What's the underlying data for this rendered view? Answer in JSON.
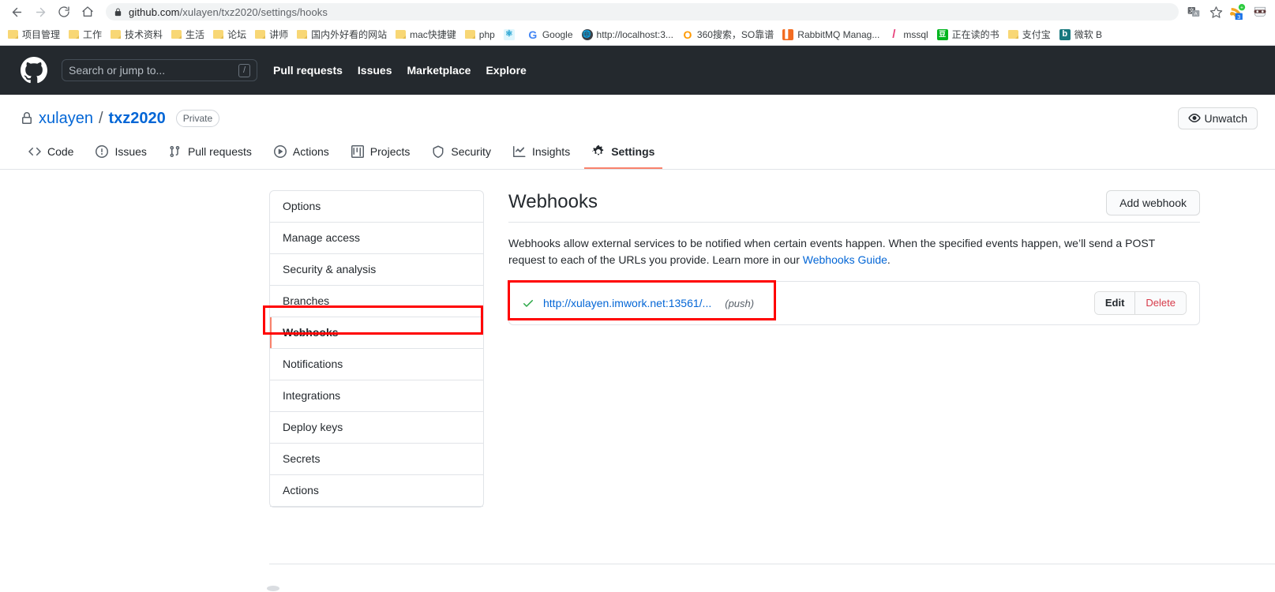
{
  "browser": {
    "url_domain": "github.com",
    "url_path": "/xulayen/txz2020/settings/hooks",
    "back_label": "Back",
    "forward_label": "Forward",
    "reload_label": "Reload",
    "home_label": "Home",
    "lock_icon": "lock-icon",
    "translate_icon": "translate-icon",
    "bookmark_star_icon": "star-icon",
    "extension_rss_badge": "3",
    "bookmarks": [
      {
        "label": "项目管理",
        "icon": "folder-icon",
        "type": "folder"
      },
      {
        "label": "工作",
        "icon": "folder-icon",
        "type": "folder"
      },
      {
        "label": "技术资料",
        "icon": "folder-icon",
        "type": "folder"
      },
      {
        "label": "生活",
        "icon": "folder-icon",
        "type": "folder"
      },
      {
        "label": "论坛",
        "icon": "folder-icon",
        "type": "folder"
      },
      {
        "label": "讲师",
        "icon": "folder-icon",
        "type": "folder"
      },
      {
        "label": "国内外好看的网站",
        "icon": "folder-icon",
        "type": "folder"
      },
      {
        "label": "mac快捷键",
        "icon": "folder-icon",
        "type": "folder"
      },
      {
        "label": "php",
        "icon": "folder-icon",
        "type": "folder"
      },
      {
        "label": "",
        "icon": "react-icon",
        "type": "site",
        "color": "#61dafb",
        "glyph": "⚛"
      },
      {
        "label": "Google",
        "icon": "google-icon",
        "type": "site",
        "color": "#ffffff",
        "glyph": "G"
      },
      {
        "label": "http://localhost:3...",
        "icon": "globe-icon",
        "type": "site",
        "color": "#3b4046",
        "glyph": "◑"
      },
      {
        "label": "360搜索，SO靠谱",
        "icon": "so360-icon",
        "type": "site",
        "color": "#ffffff",
        "glyph": "O"
      },
      {
        "label": "RabbitMQ Manag...",
        "icon": "rabbitmq-icon",
        "type": "site",
        "color": "#f36c21",
        "glyph": "▐"
      },
      {
        "label": "mssql",
        "icon": "pencil-icon",
        "type": "site",
        "color": "#ffffff",
        "glyph": "/"
      },
      {
        "label": "正在读的书",
        "icon": "douban-icon",
        "type": "site",
        "color": "#00b51d",
        "glyph": "豆"
      },
      {
        "label": "支付宝",
        "icon": "folder-icon",
        "type": "folder"
      },
      {
        "label": "微软 B",
        "icon": "bing-icon",
        "type": "site",
        "color": "#17787e",
        "glyph": "b"
      }
    ]
  },
  "gh_header": {
    "logo_icon": "github-mark-icon",
    "search_placeholder": "Search or jump to...",
    "search_value": "",
    "search_shortcut": "/",
    "nav": [
      {
        "label": "Pull requests"
      },
      {
        "label": "Issues"
      },
      {
        "label": "Marketplace"
      },
      {
        "label": "Explore"
      }
    ]
  },
  "repo": {
    "lock_icon": "lock-icon",
    "owner": "xulayen",
    "separator": "/",
    "name": "txz2020",
    "visibility": "Private",
    "watch_button": "Unwatch",
    "watch_icon": "eye-icon",
    "tabs": [
      {
        "label": "Code",
        "icon": "code-icon",
        "selected": false
      },
      {
        "label": "Issues",
        "icon": "issue-opened-icon",
        "selected": false
      },
      {
        "label": "Pull requests",
        "icon": "git-pull-request-icon",
        "selected": false
      },
      {
        "label": "Actions",
        "icon": "play-icon",
        "selected": false
      },
      {
        "label": "Projects",
        "icon": "project-board-icon",
        "selected": false
      },
      {
        "label": "Security",
        "icon": "shield-icon",
        "selected": false
      },
      {
        "label": "Insights",
        "icon": "graph-icon",
        "selected": false
      },
      {
        "label": "Settings",
        "icon": "gear-icon",
        "selected": true
      }
    ]
  },
  "settings_menu": {
    "items": [
      {
        "label": "Options",
        "selected": false
      },
      {
        "label": "Manage access",
        "selected": false
      },
      {
        "label": "Security & analysis",
        "selected": false
      },
      {
        "label": "Branches",
        "selected": false
      },
      {
        "label": "Webhooks",
        "selected": true
      },
      {
        "label": "Notifications",
        "selected": false
      },
      {
        "label": "Integrations",
        "selected": false
      },
      {
        "label": "Deploy keys",
        "selected": false
      },
      {
        "label": "Secrets",
        "selected": false
      },
      {
        "label": "Actions",
        "selected": false
      }
    ]
  },
  "main": {
    "title": "Webhooks",
    "add_button": "Add webhook",
    "description_part1": "Webhooks allow external services to be notified when certain events happen. When the specified events happen, we’ll send a POST request to each of the URLs you provide. Learn more in our ",
    "description_link": "Webhooks Guide",
    "description_part2": ".",
    "webhooks": [
      {
        "status_icon": "check-icon",
        "status_color": "#28a745",
        "url": "http://xulayen.imwork.net:13561/...",
        "events": "(push)",
        "edit_label": "Edit",
        "delete_label": "Delete"
      }
    ]
  }
}
